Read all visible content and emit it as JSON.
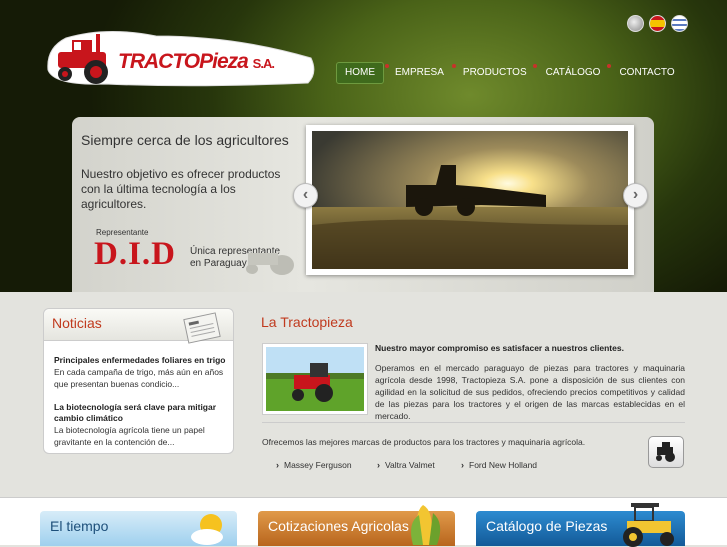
{
  "header": {
    "logo_text_1": "TRACTO",
    "logo_text_2": "Pieza",
    "logo_text_3": "S.A."
  },
  "nav": {
    "items": [
      {
        "label": "HOME"
      },
      {
        "label": "EMPRESA"
      },
      {
        "label": "PRODUCTOS"
      },
      {
        "label": "CATÁLOGO"
      },
      {
        "label": "CONTACTO"
      }
    ]
  },
  "hero": {
    "title": "Siempre cerca de los agricultores",
    "text": "Nuestro objetivo es ofrecer productos con la última tecnología a los agricultores.",
    "rep_label": "Representante",
    "rep_brand": "D.I.D",
    "rep_text": "Única representante en Paraguay"
  },
  "news": {
    "title": "Noticias",
    "items": [
      {
        "title": "Principales enfermedades foliares en trigo",
        "text": "En cada campaña de trigo, más aún en años que presentan buenas condicio..."
      },
      {
        "title": "La biotecnología será clave para mitigar cambio climático",
        "text": "La biotecnología agrícola tiene un papel gravitante en la contención de..."
      }
    ]
  },
  "main": {
    "title": "La Tractopieza",
    "headline": "Nuestro mayor compromiso es satisfacer a nuestros clientes.",
    "body": "Operamos en el mercado paraguayo de piezas para tractores y maquinaria agrícola desde 1998, Tractopieza S.A. pone a disposición de sus clientes con agilidad en la solicitud de sus pedidos, ofreciendo precios competitivos y calidad de las piezas para los tractores y el origen de las marcas establecidas en el mercado.",
    "offer": "Ofrecemos las mejores marcas de productos para los tractores y maquinaria agrícola.",
    "brands": [
      "Massey Ferguson",
      "Valtra Valmet",
      "Ford New Holland"
    ]
  },
  "footer": {
    "tiles": [
      {
        "label": "El tiempo"
      },
      {
        "label": "Cotizaciones Agricolas"
      },
      {
        "label": "Catálogo de Piezas"
      }
    ]
  }
}
